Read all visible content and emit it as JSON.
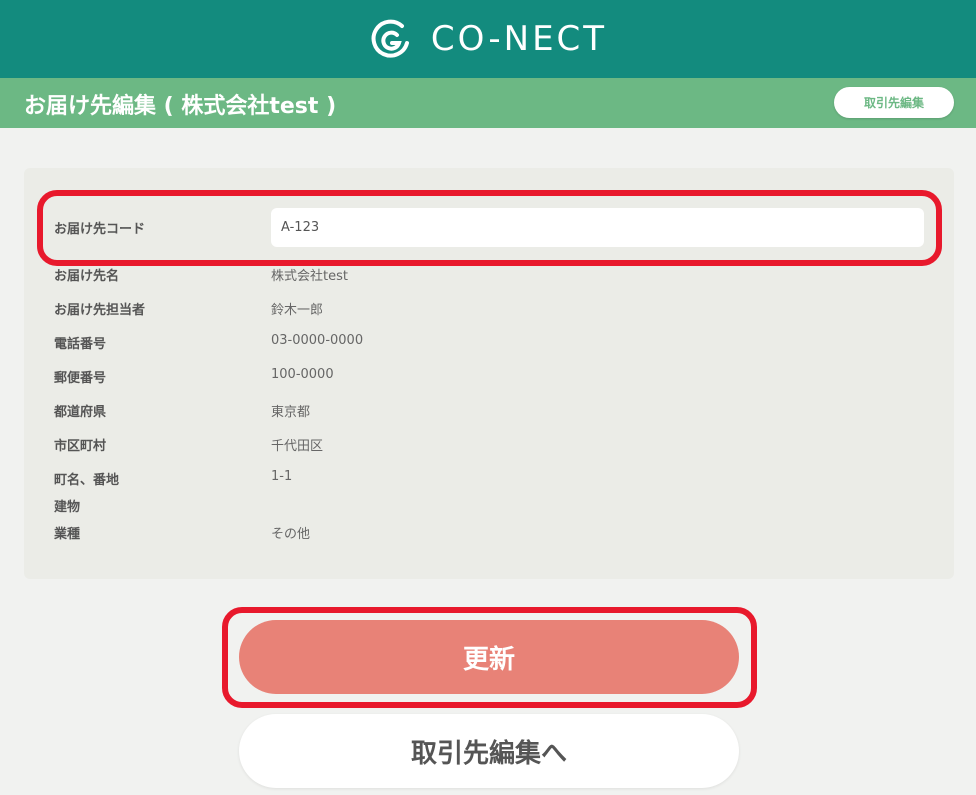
{
  "header": {
    "logo_icon": "co-nect-logo-icon",
    "logo_text": "CO-NECT",
    "background": "#138b7e"
  },
  "titlebar": {
    "title": "お届け先編集 ( 株式会社test )",
    "edit_button_label": "取引先編集",
    "background": "#6cb884"
  },
  "form": {
    "delivery_code": {
      "label": "お届け先コード",
      "value": "A-123"
    },
    "rows": [
      {
        "label": "お届け先名",
        "value": "株式会社test"
      },
      {
        "label": "お届け先担当者",
        "value": "鈴木一郎"
      },
      {
        "label": "電話番号",
        "value": "03-0000-0000"
      },
      {
        "label": "郵便番号",
        "value": "100-0000"
      },
      {
        "label": "都道府県",
        "value": "東京都"
      },
      {
        "label": "市区町村",
        "value": "千代田区"
      },
      {
        "label": "町名、番地",
        "value": "1-1"
      },
      {
        "label": "建物",
        "value": ""
      },
      {
        "label": "業種",
        "value": "その他"
      }
    ]
  },
  "actions": {
    "update_label": "更新",
    "update_color": "#e88277",
    "back_to_client_label": "取引先編集へ"
  },
  "annotation_color": "#e8192c"
}
